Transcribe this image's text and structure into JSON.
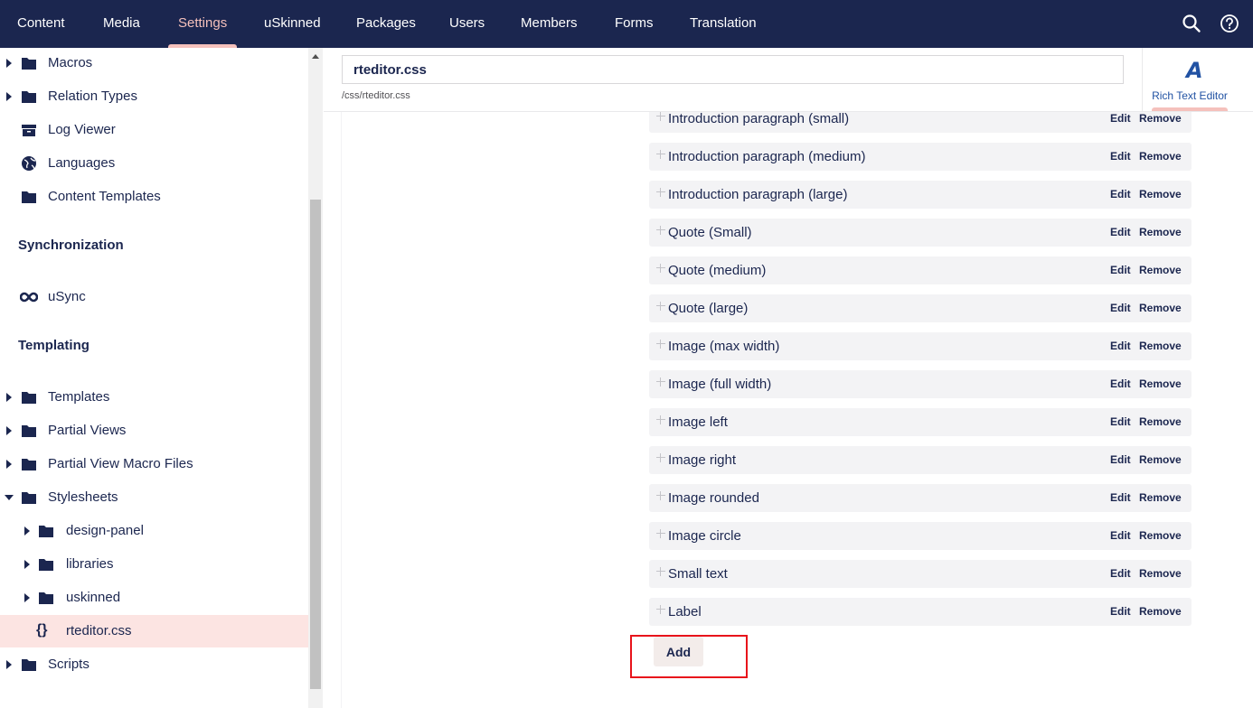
{
  "nav": {
    "items": [
      "Content",
      "Media",
      "Settings",
      "uSkinned",
      "Packages",
      "Users",
      "Members",
      "Forms",
      "Translation"
    ],
    "active": "Settings"
  },
  "sidebar": {
    "items_top": [
      {
        "label": "Macros",
        "icon": "folder-icon",
        "expandable": true
      },
      {
        "label": "Relation Types",
        "icon": "folder-icon",
        "expandable": true
      },
      {
        "label": "Log Viewer",
        "icon": "archive-box-icon",
        "expandable": false
      },
      {
        "label": "Languages",
        "icon": "globe-icon",
        "expandable": false
      },
      {
        "label": "Content Templates",
        "icon": "folder-icon",
        "expandable": false
      }
    ],
    "sync_title": "Synchronization",
    "usync_label": "uSync",
    "templating_title": "Templating",
    "templating_items": [
      {
        "label": "Templates",
        "icon": "folder-icon",
        "expandable": true
      },
      {
        "label": "Partial Views",
        "icon": "folder-icon",
        "expandable": true
      },
      {
        "label": "Partial View Macro Files",
        "icon": "folder-icon",
        "expandable": true
      },
      {
        "label": "Stylesheets",
        "icon": "folder-icon",
        "expandable": true,
        "expanded": true
      }
    ],
    "stylesheet_children": [
      {
        "label": "design-panel",
        "icon": "folder-icon"
      },
      {
        "label": "libraries",
        "icon": "folder-icon"
      },
      {
        "label": "uskinned",
        "icon": "folder-icon"
      }
    ],
    "selected_label": "rteditor.css",
    "selected_icon": "{}",
    "scripts_label": "Scripts"
  },
  "editor": {
    "name_value": "rteditor.css",
    "path": "/css/rteditor.css",
    "app_tab_label": "Rich Text Editor",
    "app_tab_icon": "A"
  },
  "rules": {
    "edit_label": "Edit",
    "remove_label": "Remove",
    "items": [
      "Introduction paragraph (small)",
      "Introduction paragraph (medium)",
      "Introduction paragraph (large)",
      "Quote (Small)",
      "Quote (medium)",
      "Quote (large)",
      "Image (max width)",
      "Image (full width)",
      "Image left",
      "Image right",
      "Image rounded",
      "Image circle",
      "Small text",
      "Label"
    ],
    "add_label": "Add"
  },
  "colors": {
    "nav_bg": "#1b264f",
    "accent": "#f5c1bc",
    "selected_bg": "#fce4e2",
    "highlight": "#e8131b"
  }
}
